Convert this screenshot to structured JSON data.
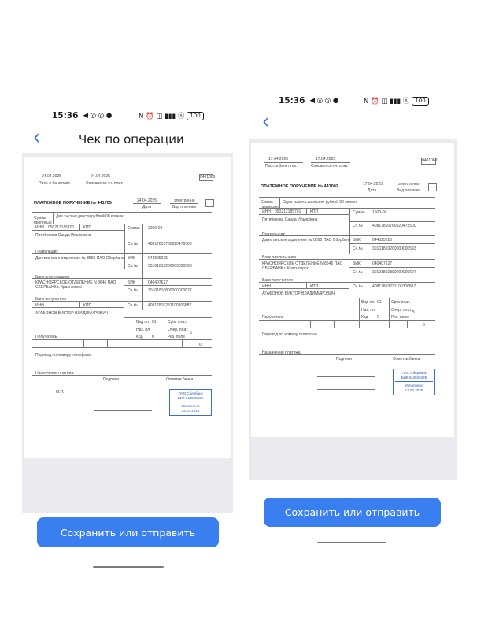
{
  "left_screen": {
    "status": {
      "time": "15:36",
      "left_icons": "◀ ◎ ◎ ●",
      "right_icons": "N ⏰ ◫ ▮▮▮ ⓢ",
      "battery": "100"
    },
    "title": "Чек по операции",
    "save_button": "Сохранить или отправить",
    "doc": {
      "date1": "24.04.2025",
      "date2": "24.04.2025",
      "label1": "Пост. в банк плат.",
      "label2": "Списано со сч. плат.",
      "code": "0401060",
      "heading": "ПЛАТЕЖНОЕ ПОРУЧЕНИЕ № 441705",
      "date3": "24.04.2025",
      "date_lbl": "Дата",
      "vid_lbl": "электронно",
      "vid_sub": "Вид платежа",
      "sum_words_lbl": "Сумма прописью",
      "sum_words": "Две тысячи двести рублей 00 копеек",
      "inn": "ИНН",
      "inn_val": "050212185701",
      "kpp": "КПП",
      "sum_lbl": "Сумма",
      "sum_val": "2200-00",
      "payer_name": "Пятибекова Саида Ильясовна",
      "acct_lbl": "Сч.№",
      "acct1": "40817810760020475500",
      "payer_lbl": "Плательщик",
      "bank1": "Дагестанское отделение № 8590 ПАО Сбербанк",
      "bik_lbl": "БИК",
      "bik1": "044525225",
      "acct2": "30101810200000000593",
      "bank_payer_lbl": "Банк плательщика",
      "bank2": "КРАСНОЯРСКОЕ ОТДЕЛЕНИЕ N 8646 ПАО СБЕРБАНК г. Красноярск",
      "bik2": "040407627",
      "acct3": "30101810800000000627",
      "bank_rec_lbl": "Банк получателя",
      "inn2": "ИНН",
      "kpp2": "КПП",
      "acct4": "40817810231100306887",
      "receiver": "АГАФОНОВ ВИКТОР ВЛАДИМИРОВИЧ",
      "vid_op": "Вид оп.",
      "vid_op_val": "01",
      "srok": "Срок плат.",
      "naz": "Наз. пл.",
      "ocher": "Очер. плат.",
      "ocher_val": "5",
      "kod": "Код",
      "kod_val": "0",
      "rez": "Рез. поле",
      "rec_lbl": "Получатель",
      "last_val": "0",
      "purpose": "Перевод по номеру телефона",
      "purpose_lbl": "Назначение платежа",
      "sign_lbl": "Подписи",
      "mark_lbl": "Отметки банка",
      "mp": "М.П.",
      "stamp_l1": "ПАО Сбербанк",
      "stamp_l2": "БИК 044525225",
      "stamp_l3": "Исполнено",
      "stamp_l4": "24.04.2025"
    }
  },
  "right_screen": {
    "status": {
      "time": "15:36",
      "left_icons": "◀ ◎ ◎ ●",
      "right_icons": "N ⏰ ◫ ▮▮▮ ⓢ",
      "battery": "100"
    },
    "save_button": "Сохранить или отправить",
    "doc": {
      "date1": "17.04.2025",
      "date2": "17.04.2025",
      "label1": "Пост. в банк плат.",
      "label2": "Списано со сч. плат.",
      "code": "0401060",
      "heading": "ПЛАТЕЖНОЕ ПОРУЧЕНИЕ № 441002",
      "date3": "17.04.2025",
      "date_lbl": "Дата",
      "vid_lbl": "электронно",
      "vid_sub": "Вид платежа",
      "sum_words_lbl": "Сумма прописью",
      "sum_words": "Одна тысяча шестьсот рублей 00 копеек",
      "inn": "ИНН",
      "inn_val": "050212185701",
      "kpp": "КПП",
      "sum_lbl": "Сумма",
      "sum_val": "1600-00",
      "payer_name": "Пятибекова Саида Ильясовна",
      "acct_lbl": "Сч.№",
      "acct1": "40817810760020475500",
      "payer_lbl": "Плательщик",
      "bank1": "Дагестанское отделение № 8590 ПАО Сбербанк",
      "bik_lbl": "БИК",
      "bik1": "044525225",
      "acct2": "30101810200000000593",
      "bank_payer_lbl": "Банк плательщика",
      "bank2": "КРАСНОЯРСКОЕ ОТДЕЛЕНИЕ N 8646 ПАО СБЕРБАНК г. Красноярск",
      "bik2": "040407627",
      "acct3": "30101810800000000627",
      "bank_rec_lbl": "Банк получателя",
      "inn2": "ИНН",
      "kpp2": "КПП",
      "acct4": "40817810231100306887",
      "receiver": "АГАФОНОВ ВИКТОР ВЛАДИМИРОВИЧ",
      "vid_op": "Вид оп.",
      "vid_op_val": "01",
      "srok": "Срок плат.",
      "naz": "Наз. пл.",
      "ocher": "Очер. плат.",
      "ocher_val": "5",
      "kod": "Код",
      "kod_val": "0",
      "rez": "Рез. поле",
      "rec_lbl": "Получатель",
      "last_val": "0",
      "purpose": "Перевод по номеру телефона",
      "purpose_lbl": "Назначение платежа",
      "sign_lbl": "Подписи",
      "mark_lbl": "Отметки банка",
      "stamp_l1": "ПАО Сбербанк",
      "stamp_l2": "БИК 044525225",
      "stamp_l3": "Исполнено",
      "stamp_l4": "17.04.2025"
    }
  }
}
